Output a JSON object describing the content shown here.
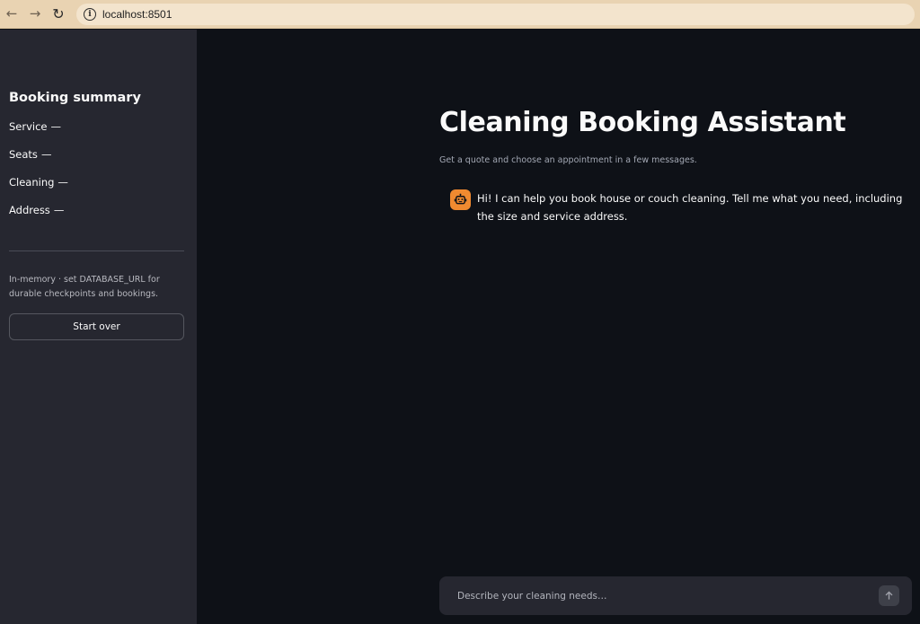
{
  "browser": {
    "url": "localhost:8501",
    "back_icon": "arrow-left-icon",
    "forward_icon": "arrow-right-icon",
    "reload_icon": "reload-icon",
    "info_icon": "info-icon"
  },
  "sidebar": {
    "title": "Booking summary",
    "items": [
      {
        "label": "Service",
        "value": "—"
      },
      {
        "label": "Seats",
        "value": "—"
      },
      {
        "label": "Cleaning",
        "value": "—"
      },
      {
        "label": "Address",
        "value": "—"
      }
    ],
    "storage_note": "In-memory · set DATABASE_URL for durable checkpoints and bookings.",
    "start_over_label": "Start over"
  },
  "main": {
    "title": "Cleaning Booking Assistant",
    "subtitle": "Get a quote and choose an appointment in a few messages.",
    "messages": [
      {
        "role": "assistant",
        "avatar_icon": "robot-icon",
        "text": "Hi! I can help you book house or couch cleaning. Tell me what you need, including the size and service address."
      }
    ]
  },
  "chat_input": {
    "placeholder": "Describe your cleaning needs…",
    "value": "",
    "send_icon": "arrow-up-icon"
  },
  "colors": {
    "browser_bar": "#e9d3b2",
    "sidebar_bg": "#262730",
    "main_bg": "#0e1117",
    "avatar_accent": "#f08a30",
    "text": "#fafafa"
  }
}
